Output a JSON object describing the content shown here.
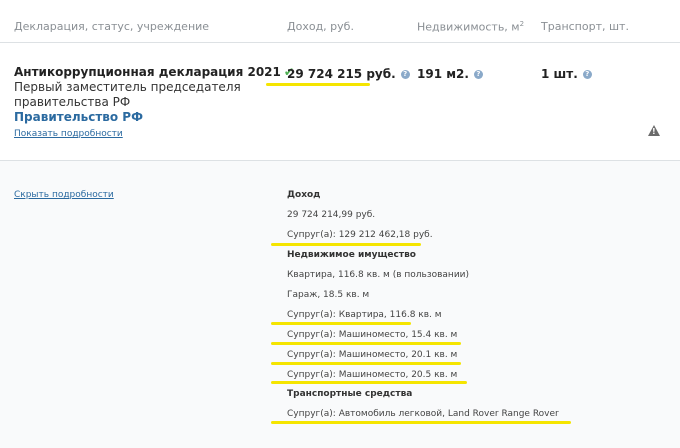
{
  "header": {
    "col_declaration": "Декларация, статус, учреждение",
    "col_income": "Доход, руб.",
    "col_realty": "Недвижимость, м",
    "col_realty_sup": "2",
    "col_transport": "Транспорт, шт."
  },
  "summary": {
    "title": "Антикоррупционная декларация 2021",
    "verified_icon": "checkmark-icon",
    "position": "Первый заместитель председателя правительства РФ",
    "organization": "Правительство РФ",
    "details_link": "Показать подробности",
    "income": "29 724 215 руб.",
    "realty": "191 м2.",
    "transport": "1 шт.",
    "info_icon": "question-icon",
    "warning_icon": "warning-icon"
  },
  "details": {
    "hide_link": "Скрыть подробности",
    "income_heading": "Доход",
    "income_own": "29 724 214,99 руб.",
    "income_spouse": "Супруг(а): 129 212 462,18 руб.",
    "realty_heading": "Недвижимое имущество",
    "realty_items": [
      "Квартира, 116.8 кв. м (в пользовании)",
      "Гараж, 18.5 кв. м",
      "Супруг(а): Квартира, 116.8 кв. м",
      "Супруг(а): Машиноместо, 15.4 кв. м",
      "Супруг(а): Машиноместо, 20.1 кв. м",
      "Супруг(а): Машиноместо, 20.5 кв. м"
    ],
    "transport_heading": "Транспортные средства",
    "transport_items": [
      "Супруг(а): Автомобиль легковой, Land Rover Range Rover"
    ]
  },
  "colors": {
    "highlight": "#f5e500",
    "link": "#2b6aa0",
    "check": "#4caf50"
  }
}
